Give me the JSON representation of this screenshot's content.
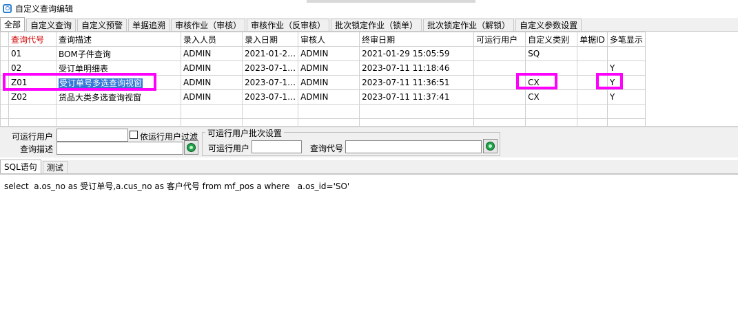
{
  "window": {
    "title": "自定义查询编辑"
  },
  "main_tabs": [
    {
      "label": "全部",
      "active": true
    },
    {
      "label": "自定义查询",
      "active": false
    },
    {
      "label": "自定义预警",
      "active": false
    },
    {
      "label": "单据追溯",
      "active": false
    },
    {
      "label": "审核作业（审核）",
      "active": false
    },
    {
      "label": "审核作业（反审核）",
      "active": false
    },
    {
      "label": "批次锁定作业（锁单）",
      "active": false
    },
    {
      "label": "批次锁定作业（解锁）",
      "active": false
    },
    {
      "label": "自定义参数设置",
      "active": false
    }
  ],
  "grid": {
    "columns": [
      "查询代号",
      "查询描述",
      "录入人员",
      "录入日期",
      "审核人",
      "终审日期",
      "可运行用户",
      "自定义类别",
      "单据ID",
      "多笔显示"
    ],
    "rows": [
      {
        "indicator": "",
        "cells": [
          "01",
          "BOM子件查询",
          "ADMIN",
          "2021-01-2…",
          "ADMIN",
          "2021-01-29 15:05:59",
          "",
          "SQ",
          "",
          ""
        ]
      },
      {
        "indicator": "",
        "cells": [
          "02",
          "受订单明细表",
          "ADMIN",
          "2023-07-1…",
          "ADMIN",
          "2023-07-11 11:18:46",
          "",
          "",
          "",
          "Y"
        ]
      },
      {
        "indicator": "▸",
        "cells": [
          "Z01",
          "受订单号多选查询视窗",
          "ADMIN",
          "2023-07-1…",
          "ADMIN",
          "2023-07-11 11:36:51",
          "",
          "CX",
          "",
          "Y"
        ]
      },
      {
        "indicator": "",
        "cells": [
          "Z02",
          "货品大类多选查询视窗",
          "ADMIN",
          "2023-07-1…",
          "ADMIN",
          "2023-07-11 11:37:41",
          "",
          "CX",
          "",
          "Y"
        ]
      }
    ]
  },
  "filter": {
    "user_label": "可运行用户",
    "user_value": "",
    "filter_by_user_label": "依运行用户过滤",
    "desc_label": "查询描述",
    "desc_value": "",
    "batch_group_label": "可运行用户批次设置",
    "batch_user_label": "可运行用户",
    "batch_user_value": "",
    "batch_code_label": "查询代号",
    "batch_code_value": ""
  },
  "bottom_tabs": [
    {
      "label": "SQL语句",
      "active": true
    },
    {
      "label": "测试",
      "active": false
    }
  ],
  "sql": {
    "text": "select  a.os_no as 受订单号,a.cus_no as 客户代号 from mf_pos a where   a.os_id='SO'"
  },
  "colors": {
    "highlight": "#ff00ff",
    "selection": "#3378d6",
    "sorted_header": "#d00000"
  }
}
